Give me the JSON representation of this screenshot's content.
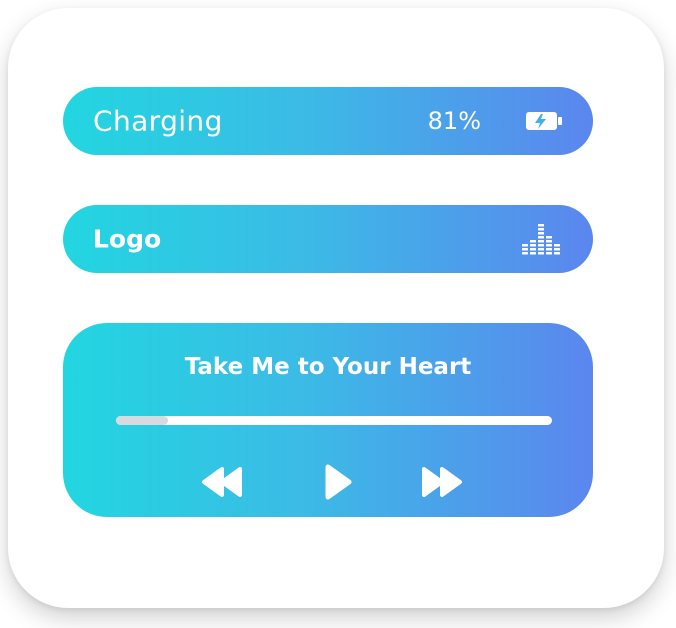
{
  "battery": {
    "status_label": "Charging",
    "percent_label": "81%",
    "icon": "battery-charging-icon"
  },
  "logo_bar": {
    "label": "Logo",
    "icon": "equalizer-icon"
  },
  "player": {
    "song_title": "Take Me to Your Heart",
    "progress": 0.12,
    "controls": {
      "rewind_icon": "rewind-icon",
      "play_icon": "play-icon",
      "forward_icon": "fast-forward-icon"
    }
  },
  "colors": {
    "gradient_start": "#22d6e0",
    "gradient_end": "#5b86ee",
    "text": "#ffffff",
    "progress_fill": "#d7dbdf",
    "progress_track": "#ffffff"
  }
}
